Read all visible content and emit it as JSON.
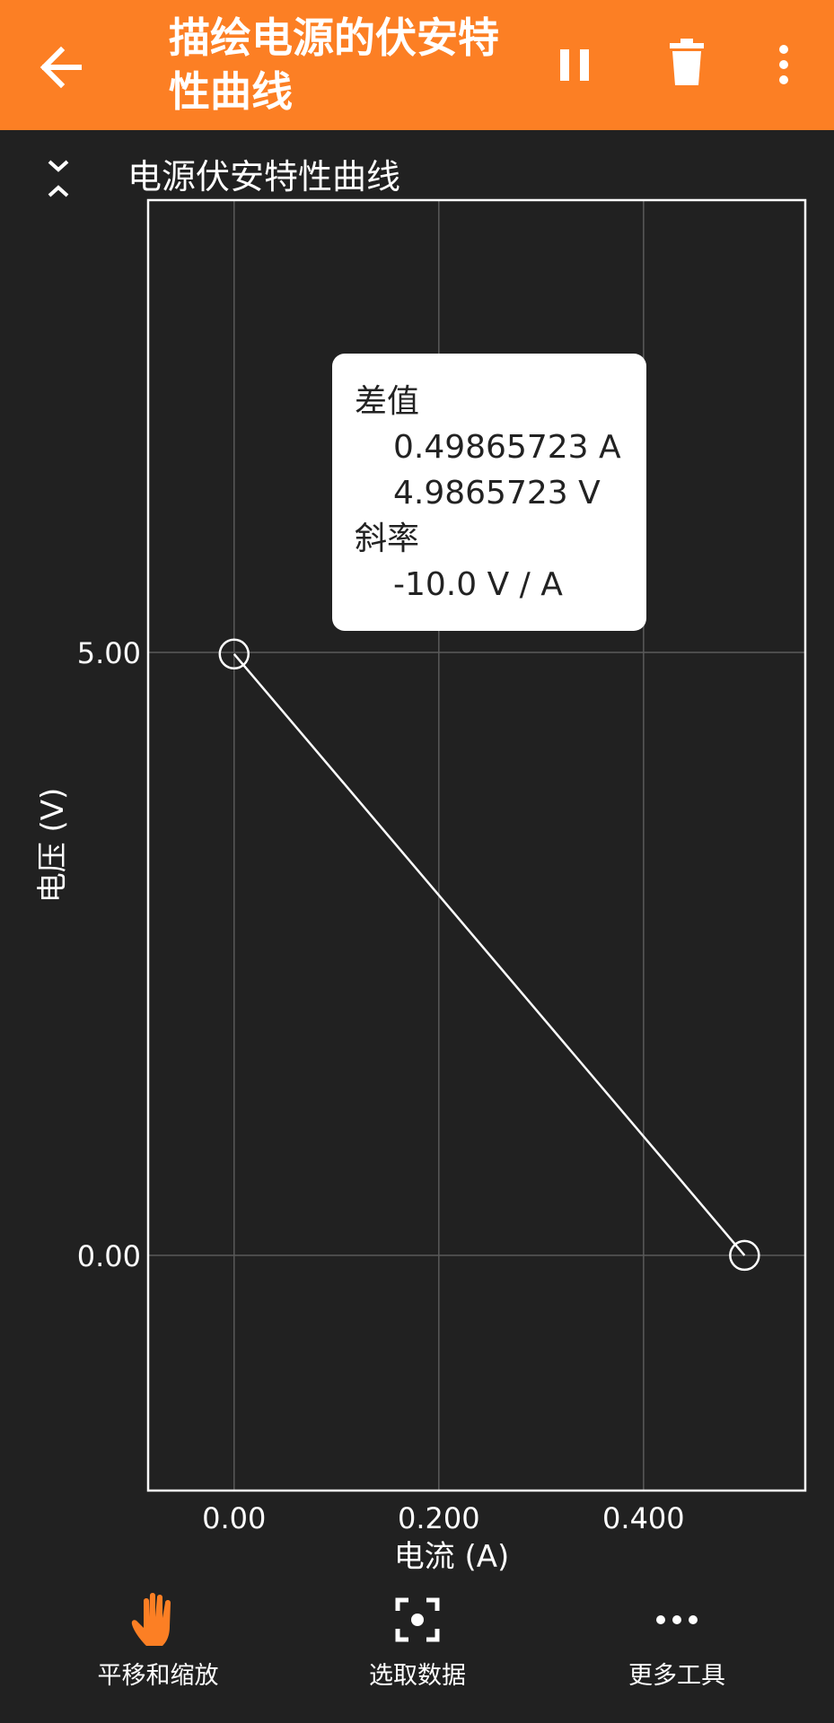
{
  "app": {
    "title": "描绘电源的伏安特性曲线"
  },
  "graph": {
    "title": "电源伏安特性曲线",
    "tooltip": {
      "diff_label": "差值",
      "diff_current": "0.49865723 A",
      "diff_voltage": "4.9865723 V",
      "slope_label": "斜率",
      "slope_value": "-10.0 V /  A"
    }
  },
  "chart_data": {
    "type": "line",
    "xlabel": "电流 (A)",
    "ylabel": "电压 (V)",
    "xlim": [
      -0.084,
      0.558
    ],
    "ylim": [
      -1.95,
      8.75
    ],
    "x_ticks": [
      0.0,
      0.2,
      0.4
    ],
    "x_tick_labels": [
      "0.00",
      "0.200",
      "0.400"
    ],
    "y_ticks": [
      0.0,
      5.0
    ],
    "y_tick_labels": [
      "0.00",
      "5.00"
    ],
    "grid": true,
    "series": [
      {
        "x": [
          0.0,
          0.49865723
        ],
        "y": [
          4.9865723,
          0.0
        ],
        "markers": "open-circle",
        "color": "#ffffff"
      }
    ]
  },
  "toolbar": {
    "pan_zoom_label": "平移和缩放",
    "select_data_label": "选取数据",
    "more_tools_label": "更多工具"
  },
  "colors": {
    "accent": "#fc7f24",
    "background": "#212121",
    "plot_line": "#ffffff",
    "grid": "#5a5a5a"
  },
  "icons": {
    "back": "arrow-left-icon",
    "pause": "pause-icon",
    "delete": "trash-icon",
    "menu": "more-vertical-icon",
    "collapse": "collapse-chevrons-icon",
    "pan": "hand-icon",
    "select": "focus-select-icon",
    "more": "more-horizontal-icon"
  }
}
